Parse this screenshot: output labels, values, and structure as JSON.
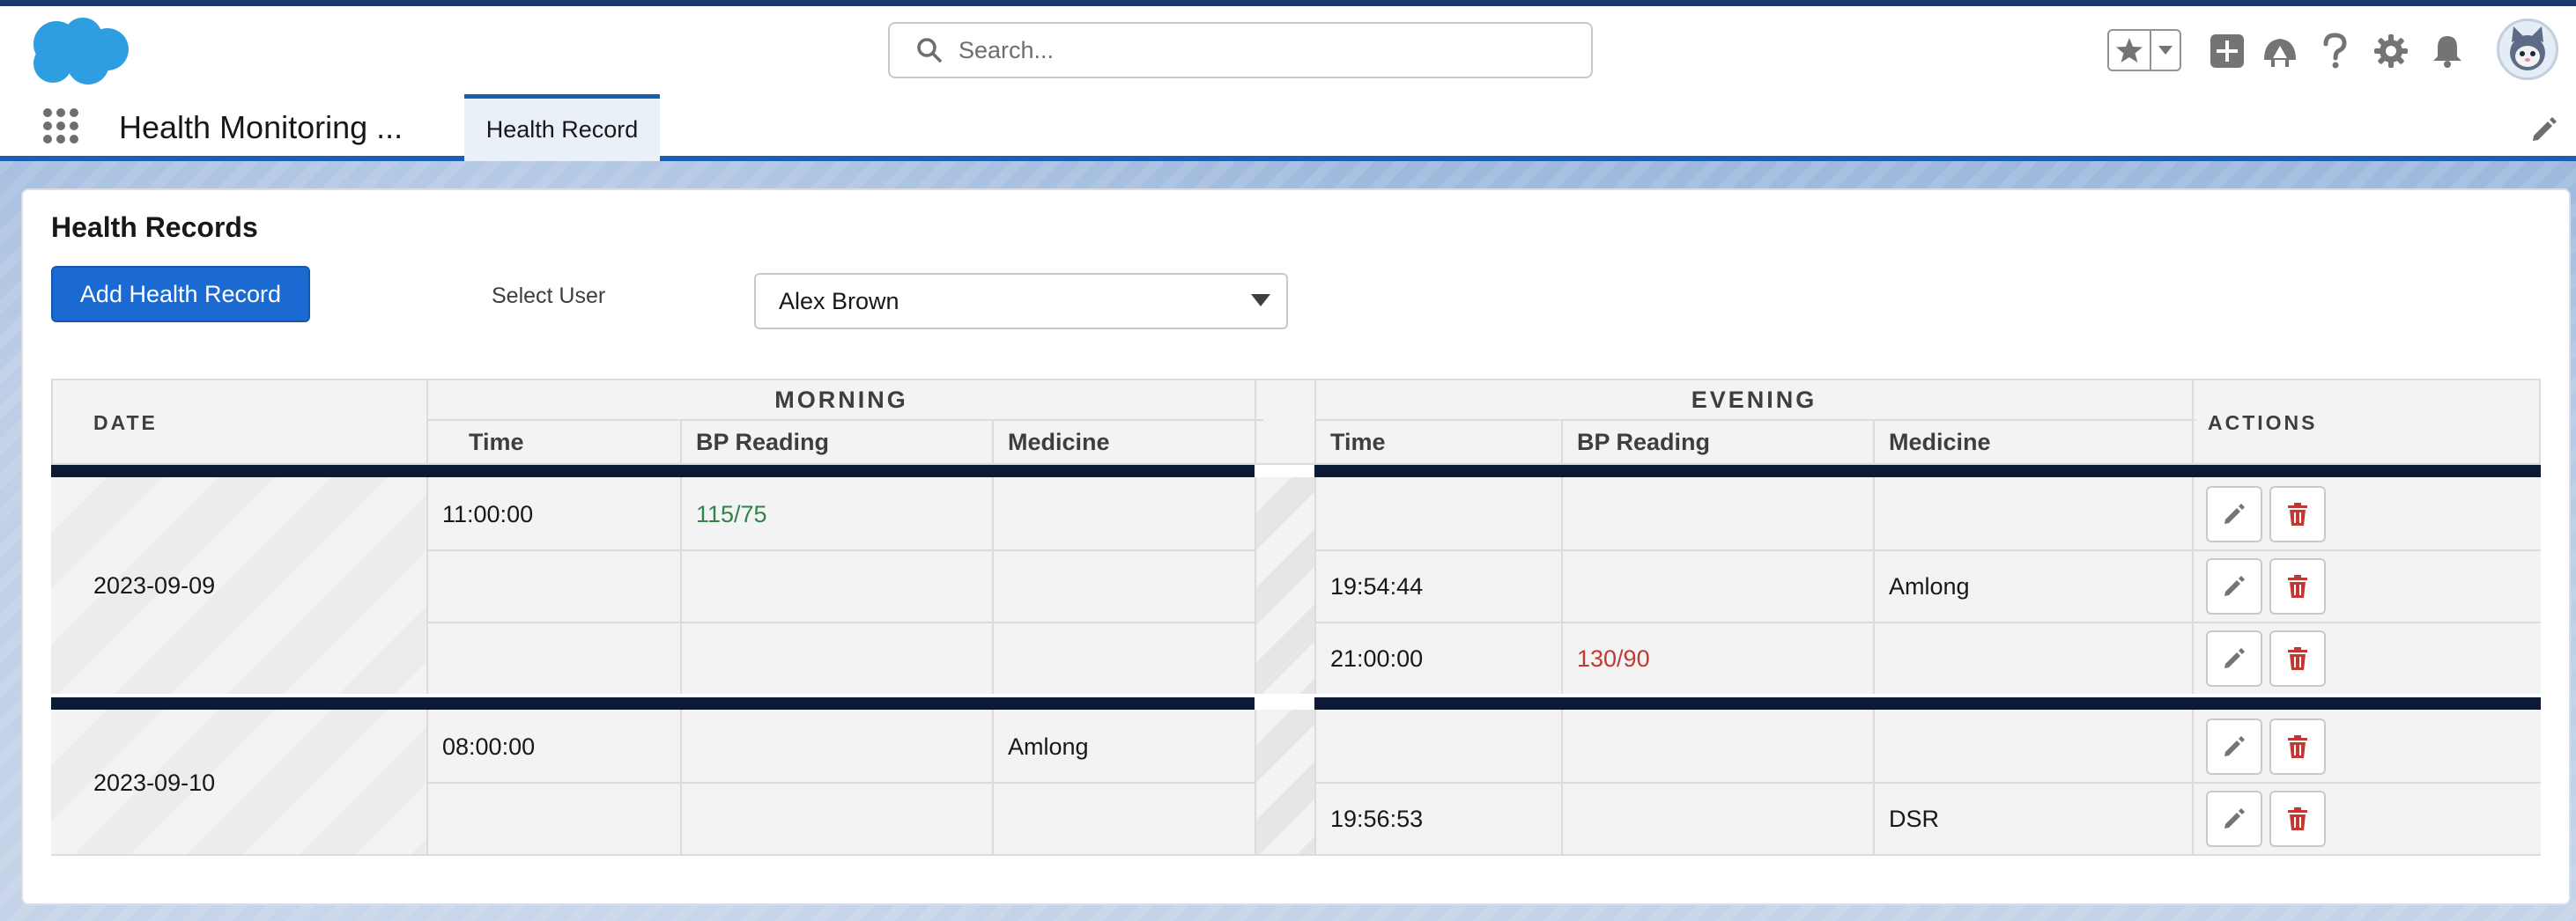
{
  "header": {
    "search_placeholder": "Search...",
    "icons": [
      "salesforce-cloud-logo",
      "search-icon",
      "star-icon",
      "chevron-down-icon",
      "add-icon",
      "trailhead-icon",
      "help-icon",
      "gear-icon",
      "bell-icon",
      "avatar"
    ]
  },
  "nav": {
    "app_name": "Health Monitoring ...",
    "active_tab": "Health Record"
  },
  "card": {
    "title": "Health Records",
    "add_button": "Add Health Record",
    "select_label": "Select User",
    "selected_user": "Alex Brown"
  },
  "table": {
    "date_header": "DATE",
    "morning_header": "MORNING",
    "evening_header": "EVENING",
    "actions_header": "ACTIONS",
    "col_time": "Time",
    "col_bp": "BP Reading",
    "col_medicine": "Medicine",
    "groups": [
      {
        "date": "2023-09-09",
        "rows": [
          {
            "m_time": "11:00:00",
            "m_bp": "115/75",
            "m_med": "",
            "e_time": "",
            "e_bp": "",
            "e_med": ""
          },
          {
            "m_time": "",
            "m_bp": "",
            "m_med": "",
            "e_time": "19:54:44",
            "e_bp": "",
            "e_med": "Amlong"
          },
          {
            "m_time": "",
            "m_bp": "",
            "m_med": "",
            "e_time": "21:00:00",
            "e_bp": "130/90",
            "e_med": ""
          }
        ]
      },
      {
        "date": "2023-09-10",
        "rows": [
          {
            "m_time": "08:00:00",
            "m_bp": "",
            "m_med": "Amlong",
            "e_time": "",
            "e_bp": "",
            "e_med": ""
          },
          {
            "m_time": "",
            "m_bp": "",
            "m_med": "",
            "e_time": "19:56:53",
            "e_bp": "",
            "e_med": "DSR"
          }
        ]
      }
    ]
  },
  "colors": {
    "brand_blue": "#1b6ad1",
    "bp_normal": "#2e844a",
    "bp_high": "#c23934",
    "separator": "#0c1a36"
  }
}
